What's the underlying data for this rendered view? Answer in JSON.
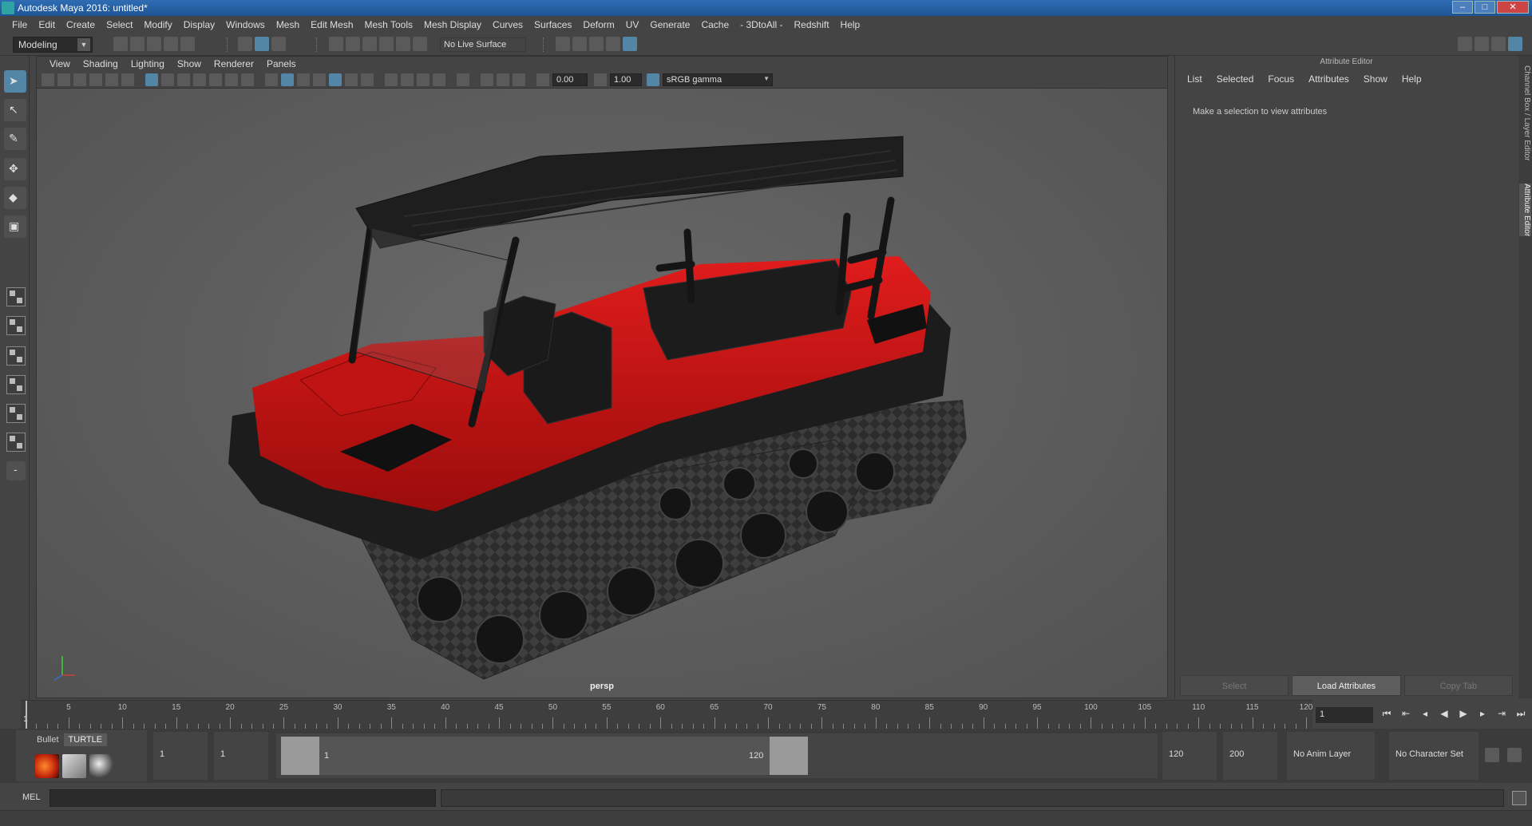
{
  "window": {
    "title": "Autodesk Maya 2016: untitled*"
  },
  "menubar": [
    "File",
    "Edit",
    "Create",
    "Select",
    "Modify",
    "Display",
    "Windows",
    "Mesh",
    "Edit Mesh",
    "Mesh Tools",
    "Mesh Display",
    "Curves",
    "Surfaces",
    "Deform",
    "UV",
    "Generate",
    "Cache",
    "- 3DtoAll -",
    "Redshift",
    "Help"
  ],
  "statusline": {
    "mode": "Modeling",
    "live_surface": "No Live Surface"
  },
  "viewport": {
    "menu": [
      "View",
      "Shading",
      "Lighting",
      "Show",
      "Renderer",
      "Panels"
    ],
    "exposure": "0.00",
    "gamma": "1.00",
    "color_space": "sRGB gamma",
    "camera": "persp"
  },
  "attribute_editor": {
    "title": "Attribute Editor",
    "menu": [
      "List",
      "Selected",
      "Focus",
      "Attributes",
      "Show",
      "Help"
    ],
    "message": "Make a selection to view attributes",
    "buttons": [
      "Select",
      "Load Attributes",
      "Copy Tab"
    ]
  },
  "side_tabs": [
    "Channel Box / Layer Editor",
    "Attribute Editor"
  ],
  "timeslider": {
    "labels": [
      "1",
      "5",
      "10",
      "15",
      "20",
      "25",
      "30",
      "35",
      "40",
      "45",
      "50",
      "55",
      "60",
      "65",
      "70",
      "75",
      "80",
      "85",
      "90",
      "95",
      "100",
      "105",
      "110",
      "115",
      "120"
    ],
    "current_frame": "1"
  },
  "range": {
    "start": "1",
    "playback_start": "1",
    "inner_start": "1",
    "inner_end": "120",
    "playback_end": "120",
    "end": "200",
    "anim_layer": "No Anim Layer",
    "character_set": "No Character Set"
  },
  "shelf": {
    "tabs": [
      "Bullet",
      "TURTLE"
    ]
  },
  "cmdline": {
    "label": "MEL"
  },
  "colors": {
    "accent": "#5285a6",
    "vehicle_body": "#d01515"
  }
}
